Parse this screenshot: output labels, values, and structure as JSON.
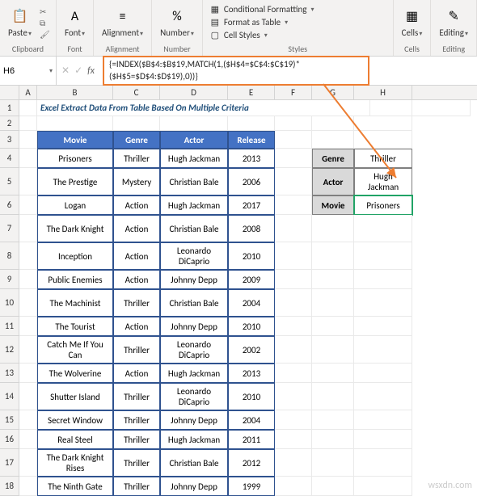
{
  "ribbon": {
    "clipboard": {
      "label": "Clipboard",
      "paste": "Paste"
    },
    "font": {
      "label": "Font",
      "btn": "Font"
    },
    "alignment": {
      "label": "Alignment",
      "btn": "Alignment"
    },
    "number": {
      "label": "Number",
      "btn": "Number"
    },
    "styles": {
      "label": "Styles",
      "conditional": "Conditional Formatting",
      "table": "Format as Table",
      "cell": "Cell Styles"
    },
    "cells": {
      "label": "Cells",
      "btn": "Cells"
    },
    "editing": {
      "label": "Editing",
      "btn": "Editing"
    }
  },
  "nameBox": "H6",
  "formula": "{=INDEX($B$4:$B$19,MATCH(1,($H$4=$C$4:$C$19)*($H$5=$D$4:$D$19),0))}",
  "columns": [
    "A",
    "B",
    "C",
    "D",
    "E",
    "F",
    "G",
    "H"
  ],
  "titleRow": "Excel Extract Data From Table Based On Multiple Criteria",
  "table": {
    "headers": {
      "movie": "Movie",
      "genre": "Genre",
      "actor": "Actor",
      "release": "Release"
    },
    "rows": [
      {
        "movie": "Prisoners",
        "genre": "Thriller",
        "actor": "Hugh Jackman",
        "release": "2013"
      },
      {
        "movie": "The Prestige",
        "genre": "Mystery",
        "actor": "Christian Bale",
        "release": "2006"
      },
      {
        "movie": "Logan",
        "genre": "Action",
        "actor": "Hugh Jackman",
        "release": "2017"
      },
      {
        "movie": "The Dark Knight",
        "genre": "Action",
        "actor": "Christian Bale",
        "release": "2008"
      },
      {
        "movie": "Inception",
        "genre": "Action",
        "actor": "Leonardo DiCaprio",
        "release": "2010"
      },
      {
        "movie": "Public Enemies",
        "genre": "Action",
        "actor": "Johnny Depp",
        "release": "2009"
      },
      {
        "movie": "The Machinist",
        "genre": "Thriller",
        "actor": "Christian Bale",
        "release": "2004"
      },
      {
        "movie": "The Tourist",
        "genre": "Action",
        "actor": "Johnny Depp",
        "release": "2010"
      },
      {
        "movie": "Catch Me If You Can",
        "genre": "Thriller",
        "actor": "Leonardo DiCaprio",
        "release": "2002"
      },
      {
        "movie": "The Wolverine",
        "genre": "Action",
        "actor": "Hugh Jackman",
        "release": "2013"
      },
      {
        "movie": "Shutter Island",
        "genre": "Thriller",
        "actor": "Leonardo DiCaprio",
        "release": "2010"
      },
      {
        "movie": "Secret Window",
        "genre": "Thriller",
        "actor": "Johnny Depp",
        "release": "2004"
      },
      {
        "movie": "Real Steel",
        "genre": "Thriller",
        "actor": "Hugh Jackman",
        "release": "2011"
      },
      {
        "movie": "The Dark Knight Rises",
        "genre": "Thriller",
        "actor": "Christian Bale",
        "release": "2012"
      },
      {
        "movie": "The Ninth Gate",
        "genre": "Thriller",
        "actor": "Johnny Depp",
        "release": "1999"
      }
    ]
  },
  "lookup": {
    "genreLabel": "Genre",
    "genreVal": "Thriller",
    "actorLabel": "Actor",
    "actorVal": "Hugh Jackman",
    "movieLabel": "Movie",
    "movieVal": "Prisoners"
  },
  "rowNumbers": [
    "1",
    "2",
    "3",
    "4",
    "5",
    "6",
    "7",
    "8",
    "9",
    "10",
    "11",
    "12",
    "13",
    "14",
    "15",
    "16",
    "17",
    "18"
  ],
  "watermark": "wsxdn.com"
}
